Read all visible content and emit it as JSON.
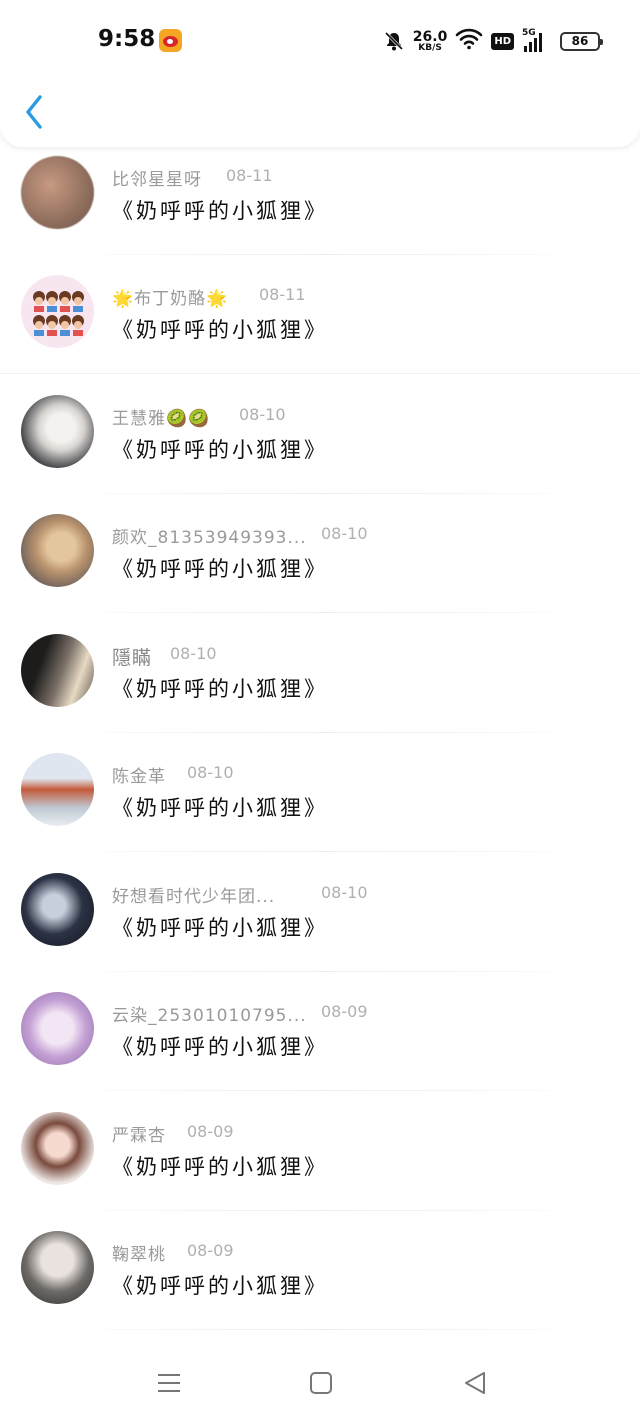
{
  "status_bar": {
    "time": "9:58",
    "net_speed_value": "26.0",
    "net_speed_unit": "KB/S",
    "hd_label": "HD",
    "network_label": "5G",
    "battery_level": "86",
    "icons": [
      "weibo-icon",
      "bell-off-icon",
      "wifi-icon",
      "signal-icon",
      "battery-icon"
    ]
  },
  "header": {
    "back_icon": "chevron-left-icon",
    "accent_color": "#2a9ae0"
  },
  "list": {
    "items": [
      {
        "name": "比邻星星呀",
        "date": "08-11",
        "comment": "《奶呼呼的小狐狸》"
      },
      {
        "name": "🌟布丁奶酪🌟",
        "date": "08-11",
        "comment": "《奶呼呼的小狐狸》"
      },
      {
        "name": "王慧雅🥝🥝",
        "date": "08-10",
        "comment": "《奶呼呼的小狐狸》"
      },
      {
        "name": "颜欢_81353949393...",
        "date": "08-10",
        "comment": "《奶呼呼的小狐狸》"
      },
      {
        "name": "隱瞞",
        "date": "08-10",
        "comment": "《奶呼呼的小狐狸》"
      },
      {
        "name": "陈金革",
        "date": "08-10",
        "comment": "《奶呼呼的小狐狸》"
      },
      {
        "name": "好想看时代少年团...",
        "date": "08-10",
        "comment": "《奶呼呼的小狐狸》"
      },
      {
        "name": "云染_25301010795...",
        "date": "08-09",
        "comment": "《奶呼呼的小狐狸》"
      },
      {
        "name": "严霖杏",
        "date": "08-09",
        "comment": "《奶呼呼的小狐狸》"
      },
      {
        "name": "鞠翠桃",
        "date": "08-09",
        "comment": "《奶呼呼的小狐狸》"
      }
    ]
  },
  "navbar": {
    "icons": [
      "menu-icon",
      "home-square-icon",
      "back-triangle-icon"
    ]
  }
}
